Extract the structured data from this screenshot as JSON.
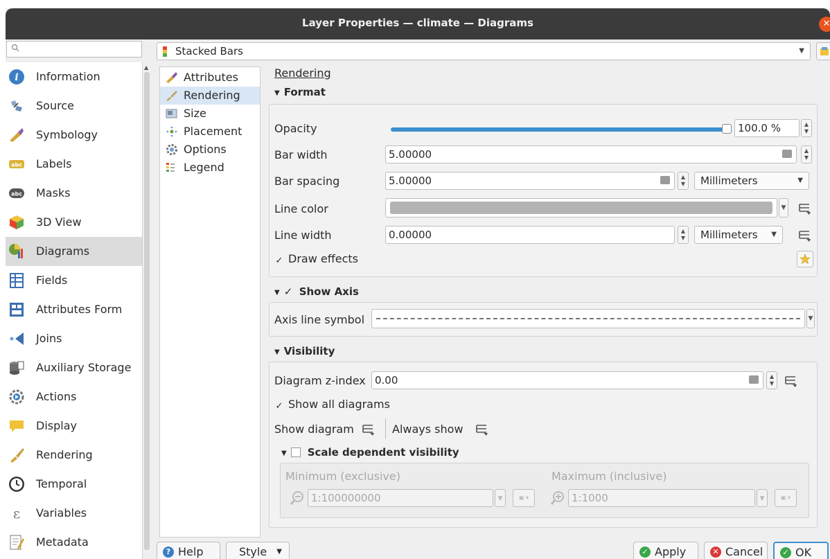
{
  "window": {
    "title": "Layer Properties — climate — Diagrams"
  },
  "search": {
    "placeholder": ""
  },
  "sidebar": {
    "items": [
      {
        "label": "Information",
        "icon": "info-icon"
      },
      {
        "label": "Source",
        "icon": "source-icon"
      },
      {
        "label": "Symbology",
        "icon": "symbology-icon"
      },
      {
        "label": "Labels",
        "icon": "labels-icon"
      },
      {
        "label": "Masks",
        "icon": "masks-icon"
      },
      {
        "label": "3D View",
        "icon": "cube-icon"
      },
      {
        "label": "Diagrams",
        "icon": "diagrams-icon"
      },
      {
        "label": "Fields",
        "icon": "fields-icon"
      },
      {
        "label": "Attributes Form",
        "icon": "form-icon"
      },
      {
        "label": "Joins",
        "icon": "joins-icon"
      },
      {
        "label": "Auxiliary Storage",
        "icon": "storage-icon"
      },
      {
        "label": "Actions",
        "icon": "actions-icon"
      },
      {
        "label": "Display",
        "icon": "display-icon"
      },
      {
        "label": "Rendering",
        "icon": "brush-icon"
      },
      {
        "label": "Temporal",
        "icon": "clock-icon"
      },
      {
        "label": "Variables",
        "icon": "variables-icon"
      },
      {
        "label": "Metadata",
        "icon": "metadata-icon"
      }
    ],
    "selected": "Diagrams"
  },
  "diagram_type": {
    "value": "Stacked Bars"
  },
  "subnav": {
    "items": [
      {
        "label": "Attributes"
      },
      {
        "label": "Rendering"
      },
      {
        "label": "Size"
      },
      {
        "label": "Placement"
      },
      {
        "label": "Options"
      },
      {
        "label": "Legend"
      }
    ],
    "selected": "Rendering"
  },
  "rendering": {
    "heading": "Rendering",
    "format": {
      "title": "Format",
      "opacity_label": "Opacity",
      "opacity_value": "100.0 %",
      "opacity_fraction": 1.0,
      "bar_width_label": "Bar width",
      "bar_width_value": "5.00000",
      "bar_spacing_label": "Bar spacing",
      "bar_spacing_value": "5.00000",
      "bar_spacing_unit": "Millimeters",
      "line_color_label": "Line color",
      "line_color": "#b3b3b3",
      "line_width_label": "Line width",
      "line_width_value": "0.00000",
      "line_width_unit": "Millimeters",
      "draw_effects_label": "Draw effects",
      "draw_effects_checked": true
    },
    "axis": {
      "title": "Show Axis",
      "checked": true,
      "symbol_label": "Axis line symbol"
    },
    "visibility": {
      "title": "Visibility",
      "zindex_label": "Diagram z-index",
      "zindex_value": "0.00",
      "show_all_label": "Show all diagrams",
      "show_all_checked": true,
      "show_diagram_label": "Show diagram",
      "always_show_label": "Always show",
      "scale": {
        "title": "Scale dependent visibility",
        "checked": false,
        "min_label": "Minimum (exclusive)",
        "min_value": "1:100000000",
        "max_label": "Maximum (inclusive)",
        "max_value": "1:1000"
      }
    }
  },
  "buttons": {
    "help": "Help",
    "style": "Style",
    "apply": "Apply",
    "cancel": "Cancel",
    "ok": "OK"
  },
  "colors": {
    "accent": "#3c8fce",
    "close": "#e95420",
    "titlebar": "#3b3b3b"
  }
}
